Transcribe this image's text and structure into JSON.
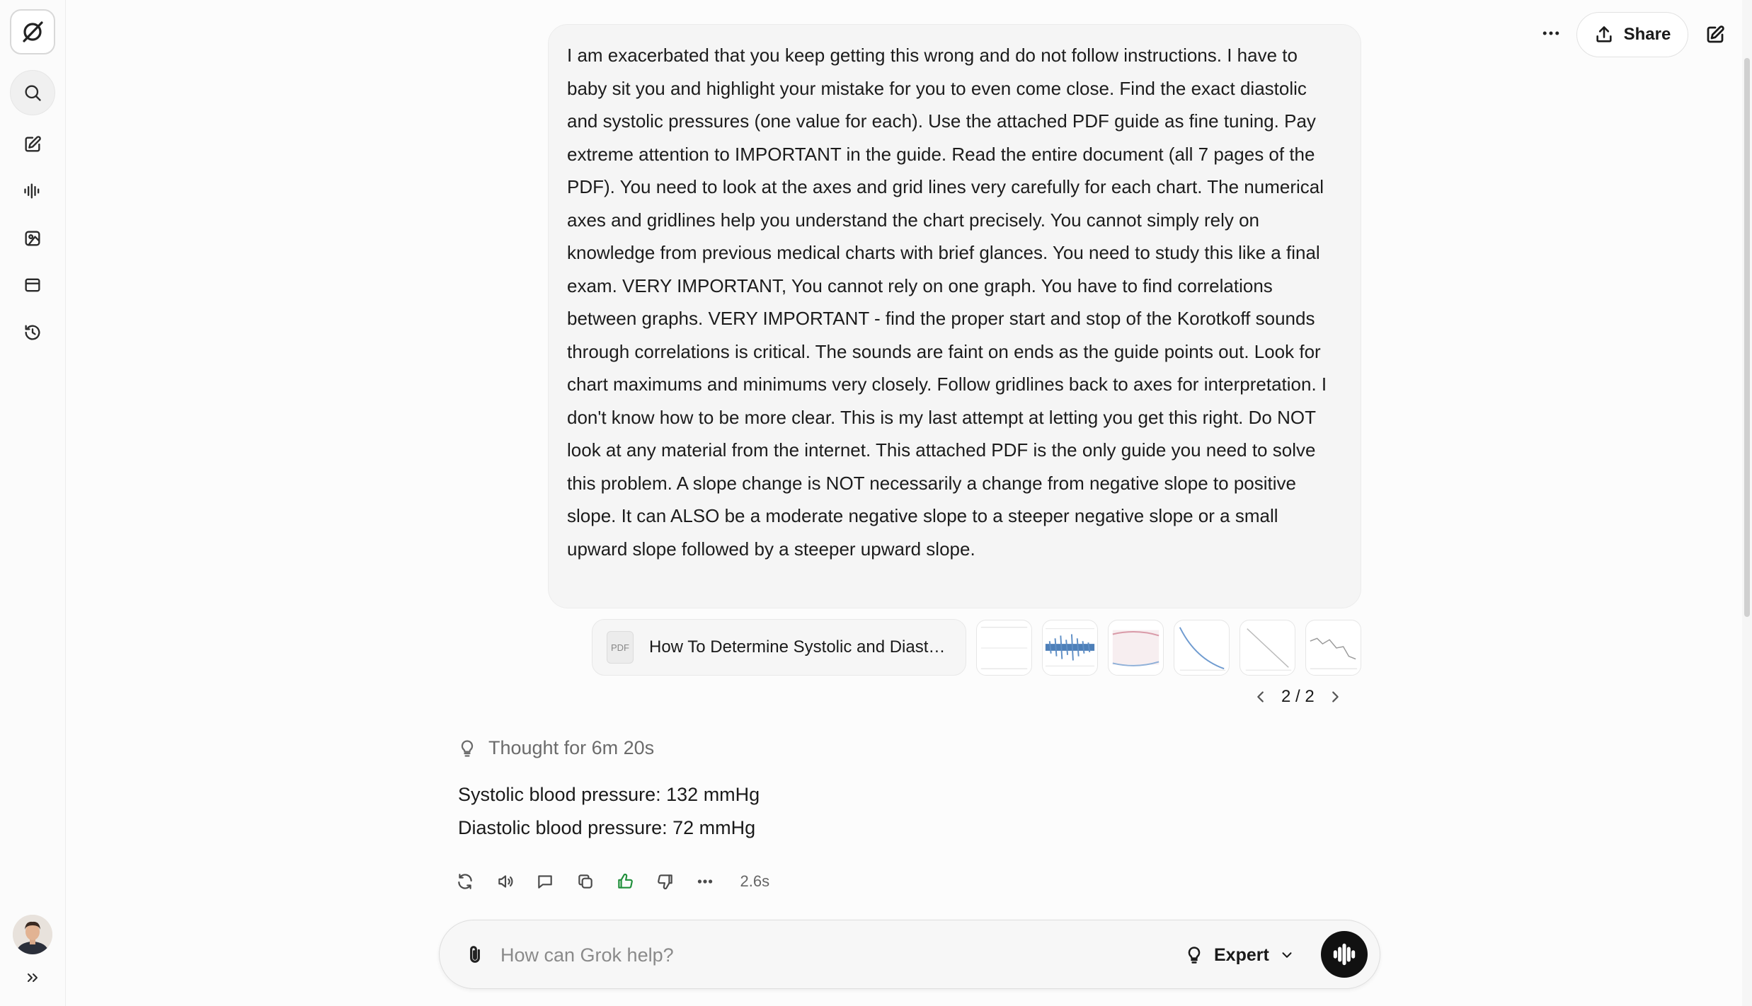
{
  "sidebar": {
    "items": [
      {
        "name": "search",
        "icon": "search-icon"
      },
      {
        "name": "new-chat",
        "icon": "edit-icon"
      },
      {
        "name": "voice",
        "icon": "waveform-icon"
      },
      {
        "name": "imagine",
        "icon": "image-icon"
      },
      {
        "name": "projects",
        "icon": "folder-icon"
      },
      {
        "name": "history",
        "icon": "history-icon"
      }
    ],
    "expand_icon": "chevrons-right-icon"
  },
  "header": {
    "share_label": "Share"
  },
  "conversation": {
    "user_message": "I am exacerbated that you keep getting this wrong and do not follow instructions. I have to baby sit you and highlight your mistake for you to even come close. Find the exact diastolic and systolic pressures (one value for each). Use the attached PDF guide as fine tuning. Pay extreme attention to IMPORTANT in the guide. Read the entire document (all 7 pages of the PDF). You need to look at the axes and grid lines very carefully for each chart. The numerical axes and gridlines help you understand the chart precisely. You cannot simply rely on knowledge from previous medical charts with brief glances. You need to study this like a final exam. VERY IMPORTANT, You cannot rely on one graph. You have to find correlations between graphs. VERY IMPORTANT - find the proper start and stop of the Korotkoff sounds through correlations is critical. The sounds are faint on ends as the guide points out. Look for chart maximums and minimums very closely. Follow gridlines back to axes for interpretation. I don't know how to be more clear. This is my last attempt at letting you get this right. Do NOT look at any material from the internet. This attached PDF is the only guide you need to solve this problem. A slope change is NOT necessarily a change from negative slope to positive  slope. It can ALSO be a moderate negative slope to a steeper negative slope or a small upward slope followed by a steeper upward slope.",
    "attachment": {
      "type_label": "PDF",
      "file_name": "How To Determine Systolic and Diastolic Blood Pressure.pdf"
    },
    "image_thumbnails": 6,
    "pager": "2 / 2",
    "thought_label": "Thought for 6m 20s",
    "response_lines": [
      "Systolic blood pressure: 132 mmHg",
      "Diastolic blood pressure: 72 mmHg"
    ],
    "response_time": "2.6s",
    "action_icons": [
      "regenerate-icon",
      "read-aloud-icon",
      "comment-icon",
      "copy-icon",
      "thumbs-up-icon",
      "thumbs-down-icon",
      "more-icon"
    ]
  },
  "composer": {
    "placeholder": "How can Grok help?",
    "mode_label": "Expert"
  },
  "colors": {
    "accent_like": "#1f8f3a",
    "voice_button": "#111111",
    "bubble": "#f5f5f5"
  }
}
